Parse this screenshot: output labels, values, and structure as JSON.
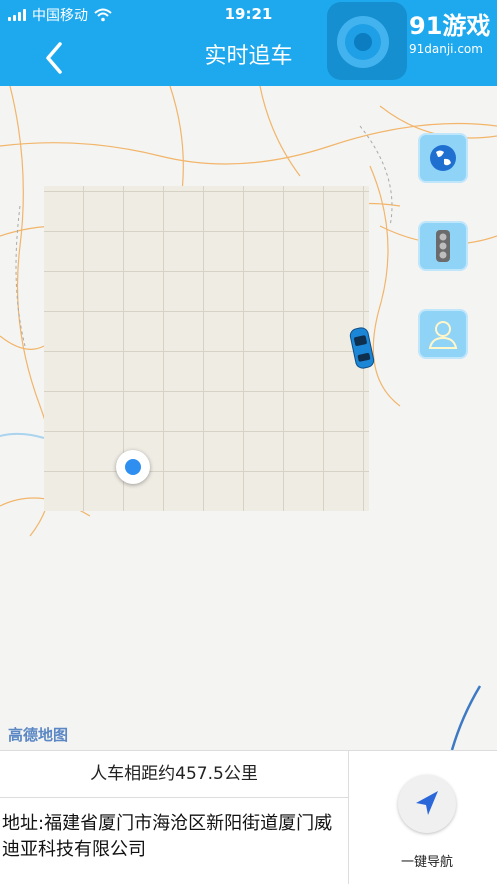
{
  "status_bar": {
    "carrier": "中国移动",
    "time": "19:21"
  },
  "watermark": {
    "brand": "游戏",
    "url": "91danji.com",
    "logo_text": "91"
  },
  "header": {
    "title": "实时追车"
  },
  "map": {
    "attribution": "高德地图",
    "buttons": [
      "globe-icon",
      "traffic-light-icon",
      "person-icon"
    ]
  },
  "info": {
    "distance_text": "人车相距约457.5公里",
    "address": "地址:福建省厦门市海沧区新阳街道厦门威迪亚科技有限公司",
    "nav_label": "一键导航"
  },
  "colors": {
    "accent": "#1ea9ef",
    "location_dot": "#2f8ff0",
    "road": "#f2b56a"
  }
}
